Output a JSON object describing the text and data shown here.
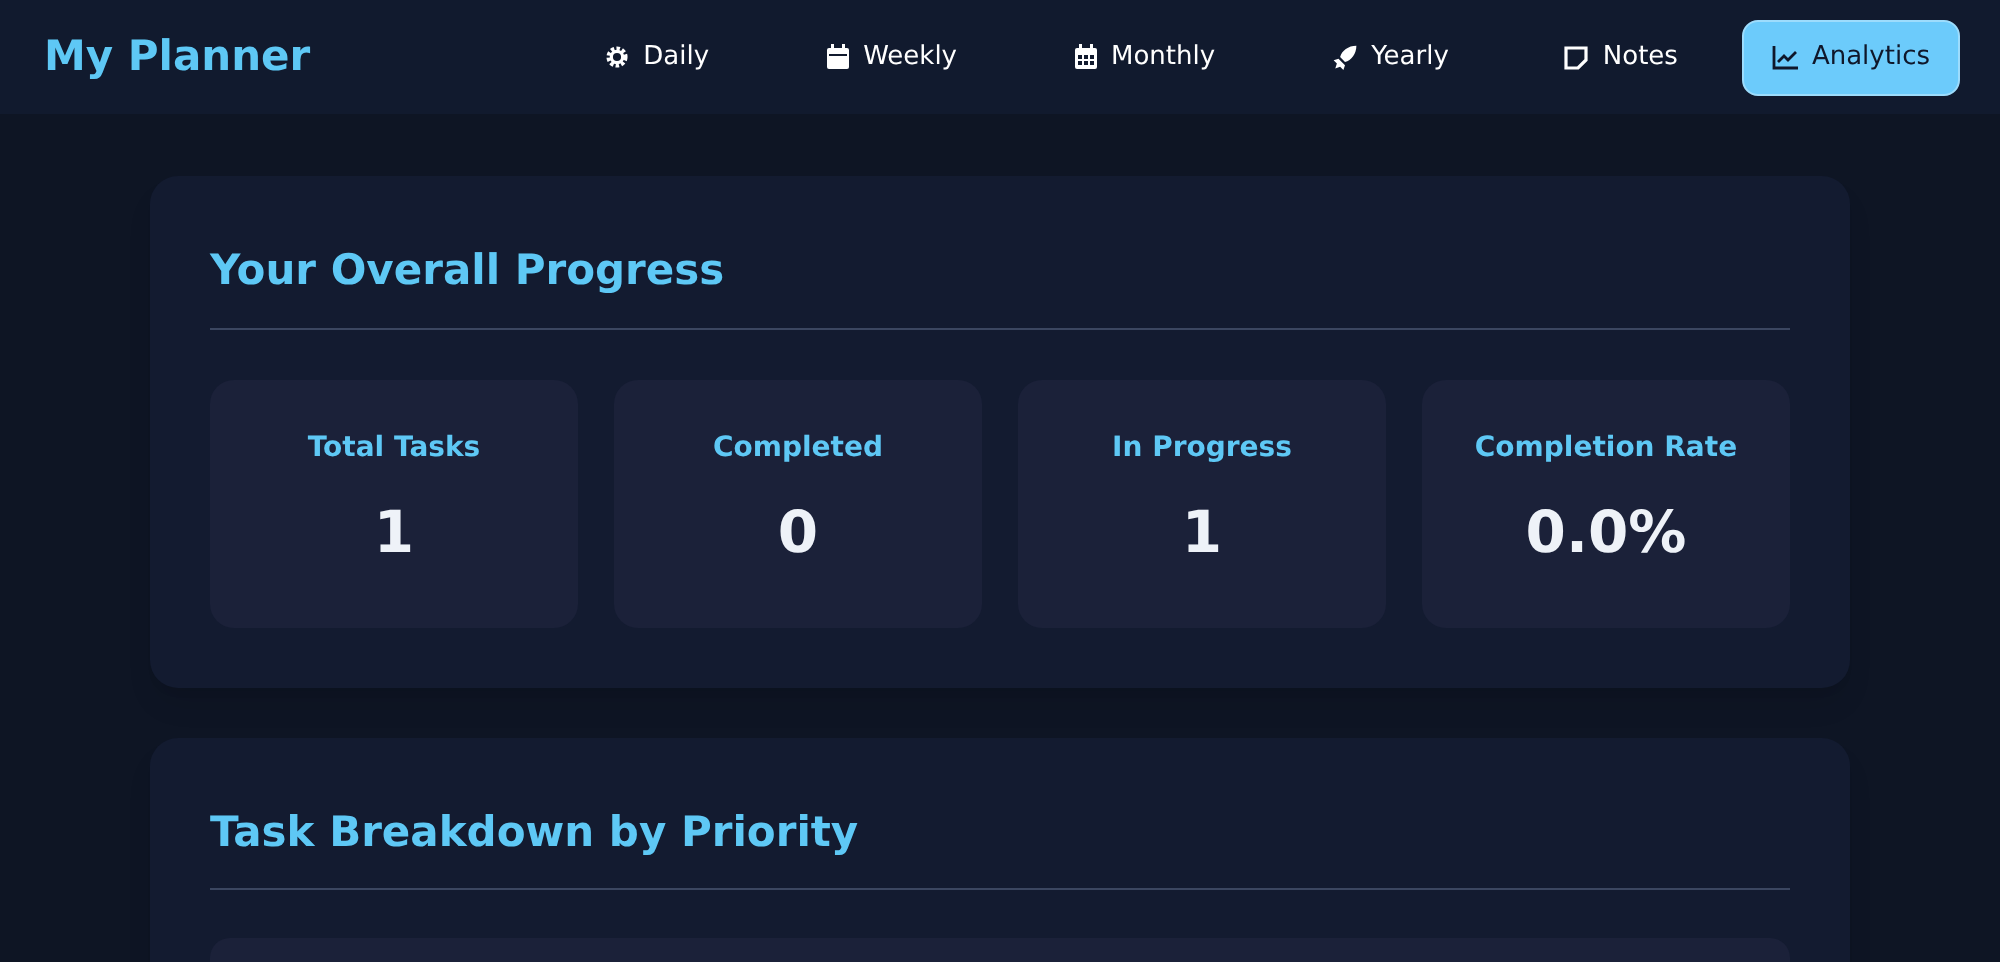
{
  "app_title": "My Planner",
  "nav": [
    {
      "label": "Daily",
      "selected": false
    },
    {
      "label": "Weekly",
      "selected": false
    },
    {
      "label": "Monthly",
      "selected": false
    },
    {
      "label": "Yearly",
      "selected": false
    },
    {
      "label": "Notes",
      "selected": false
    },
    {
      "label": "Analytics",
      "selected": true
    }
  ],
  "overall_progress": {
    "title": "Your Overall Progress",
    "stats": [
      {
        "label": "Total Tasks",
        "value": "1"
      },
      {
        "label": "Completed",
        "value": "0"
      },
      {
        "label": "In Progress",
        "value": "1"
      },
      {
        "label": "Completion Rate",
        "value": "0.0%"
      }
    ]
  },
  "priority_breakdown": {
    "title": "Task Breakdown by Priority"
  }
}
